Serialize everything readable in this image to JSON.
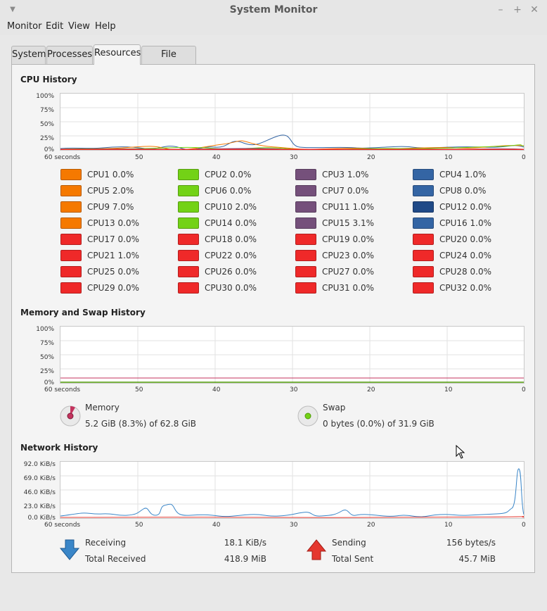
{
  "window": {
    "title": "System Monitor"
  },
  "menu": [
    "Monitor",
    "Edit",
    "View",
    "Help"
  ],
  "tabs": [
    {
      "label": "System",
      "active": false
    },
    {
      "label": "Processes",
      "active": false
    },
    {
      "label": "Resources",
      "active": true
    },
    {
      "label": "File Systems",
      "active": false
    }
  ],
  "cpu": {
    "title": "CPU History",
    "y_labels": [
      "100%",
      "75%",
      "50%",
      "25%",
      "0%"
    ],
    "x_labels": [
      "60 seconds",
      "50",
      "40",
      "30",
      "20",
      "10",
      "0"
    ],
    "cores": [
      {
        "label": "CPU1",
        "value": "0.0%",
        "color": "#f57900"
      },
      {
        "label": "CPU2",
        "value": "0.0%",
        "color": "#73d216"
      },
      {
        "label": "CPU3",
        "value": "1.0%",
        "color": "#75507b"
      },
      {
        "label": "CPU4",
        "value": "1.0%",
        "color": "#3465a4"
      },
      {
        "label": "CPU5",
        "value": "2.0%",
        "color": "#f57900"
      },
      {
        "label": "CPU6",
        "value": "0.0%",
        "color": "#73d216"
      },
      {
        "label": "CPU7",
        "value": "0.0%",
        "color": "#75507b"
      },
      {
        "label": "CPU8",
        "value": "0.0%",
        "color": "#3465a4"
      },
      {
        "label": "CPU9",
        "value": "7.0%",
        "color": "#f57900"
      },
      {
        "label": "CPU10",
        "value": "2.0%",
        "color": "#73d216"
      },
      {
        "label": "CPU11",
        "value": "1.0%",
        "color": "#75507b"
      },
      {
        "label": "CPU12",
        "value": "0.0%",
        "color": "#204a87"
      },
      {
        "label": "CPU13",
        "value": "0.0%",
        "color": "#f57900"
      },
      {
        "label": "CPU14",
        "value": "0.0%",
        "color": "#73d216"
      },
      {
        "label": "CPU15",
        "value": "3.1%",
        "color": "#75507b"
      },
      {
        "label": "CPU16",
        "value": "1.0%",
        "color": "#3465a4"
      },
      {
        "label": "CPU17",
        "value": "0.0%",
        "color": "#ef2929"
      },
      {
        "label": "CPU18",
        "value": "0.0%",
        "color": "#ef2929"
      },
      {
        "label": "CPU19",
        "value": "0.0%",
        "color": "#ef2929"
      },
      {
        "label": "CPU20",
        "value": "0.0%",
        "color": "#ef2929"
      },
      {
        "label": "CPU21",
        "value": "1.0%",
        "color": "#ef2929"
      },
      {
        "label": "CPU22",
        "value": "0.0%",
        "color": "#ef2929"
      },
      {
        "label": "CPU23",
        "value": "0.0%",
        "color": "#ef2929"
      },
      {
        "label": "CPU24",
        "value": "0.0%",
        "color": "#ef2929"
      },
      {
        "label": "CPU25",
        "value": "0.0%",
        "color": "#ef2929"
      },
      {
        "label": "CPU26",
        "value": "0.0%",
        "color": "#ef2929"
      },
      {
        "label": "CPU27",
        "value": "0.0%",
        "color": "#ef2929"
      },
      {
        "label": "CPU28",
        "value": "0.0%",
        "color": "#ef2929"
      },
      {
        "label": "CPU29",
        "value": "0.0%",
        "color": "#ef2929"
      },
      {
        "label": "CPU30",
        "value": "0.0%",
        "color": "#ef2929"
      },
      {
        "label": "CPU31",
        "value": "0.0%",
        "color": "#ef2929"
      },
      {
        "label": "CPU32",
        "value": "0.0%",
        "color": "#ef2929"
      }
    ]
  },
  "memory": {
    "title": "Memory and Swap History",
    "y_labels": [
      "100%",
      "75%",
      "50%",
      "25%",
      "0%"
    ],
    "x_labels": [
      "60 seconds",
      "50",
      "40",
      "30",
      "20",
      "10",
      "0"
    ],
    "memory_label": "Memory",
    "memory_value": "5.2 GiB (8.3%) of 62.8 GiB",
    "memory_fraction": 0.083,
    "memory_color": "#c4335e",
    "swap_label": "Swap",
    "swap_value": "0 bytes (0.0%) of 31.9 GiB",
    "swap_fraction": 0.0,
    "swap_color": "#4e9a06"
  },
  "network": {
    "title": "Network History",
    "y_labels": [
      "92.0 KiB/s",
      "69.0 KiB/s",
      "46.0 KiB/s",
      "23.0 KiB/s",
      "0.0 KiB/s"
    ],
    "x_labels": [
      "60 seconds",
      "50",
      "40",
      "30",
      "20",
      "10",
      "0"
    ],
    "receiving_label": "Receiving",
    "receiving_value": "18.1 KiB/s",
    "total_received_label": "Total Received",
    "total_received_value": "418.9 MiB",
    "sending_label": "Sending",
    "sending_value": "156 bytes/s",
    "total_sent_label": "Total Sent",
    "total_sent_value": "45.7 MiB",
    "receive_color": "#3a86c8",
    "send_color": "#e5382f"
  }
}
